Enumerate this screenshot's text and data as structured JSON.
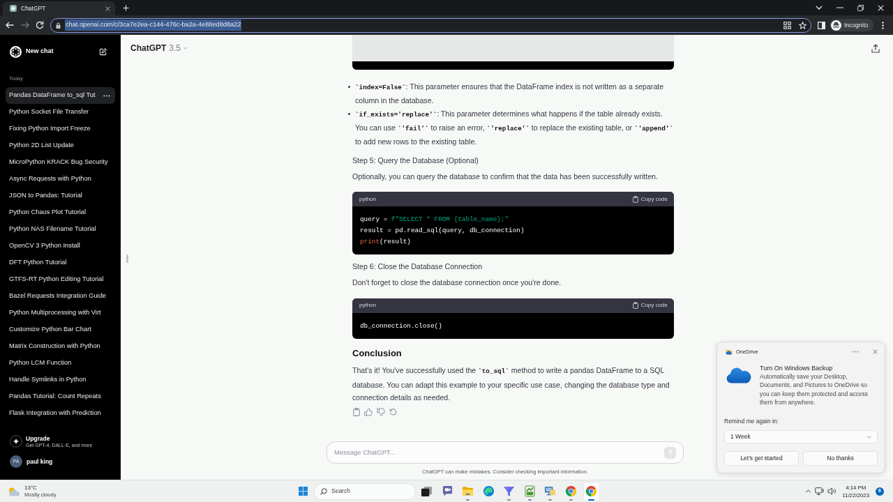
{
  "browser": {
    "tabs": [
      {
        "title": "ChatGPT",
        "selected": true
      }
    ],
    "forward_disabled": true,
    "url": "chat.openai.com/c/3ca7e2ea-c144-476c-ba2a-4e88ed8d8a22",
    "url_selected": true,
    "profile": "Incognito"
  },
  "sidebar": {
    "new_chat": "New chat",
    "section": "Today",
    "items": [
      {
        "label": "Pandas DataFrame to_sql Tut",
        "selected": true
      },
      {
        "label": "Python Socket File Transfer",
        "selected": false
      },
      {
        "label": "Fixing Python Import Freeze",
        "selected": false
      },
      {
        "label": "Python 2D List Update",
        "selected": false
      },
      {
        "label": "MicroPython KRACK Bug Security",
        "selected": false
      },
      {
        "label": "Async Requests with Python",
        "selected": false
      },
      {
        "label": "JSON to Pandas: Tutorial",
        "selected": false
      },
      {
        "label": "Python Chaos Plot Tutorial",
        "selected": false
      },
      {
        "label": "Python NAS Filename Tutorial",
        "selected": false
      },
      {
        "label": "OpenCV 3 Python Install",
        "selected": false
      },
      {
        "label": "DFT Python Tutorial",
        "selected": false
      },
      {
        "label": "GTFS-RT Python Editing Tutorial",
        "selected": false
      },
      {
        "label": "Bazel Requests Integration Guide",
        "selected": false
      },
      {
        "label": "Python Multiprocessing with Virt",
        "selected": false
      },
      {
        "label": "Customize Python Bar Chart",
        "selected": false
      },
      {
        "label": "Matrix Construction with Python",
        "selected": false
      },
      {
        "label": "Python LCM Function",
        "selected": false
      },
      {
        "label": "Handle Symlinks in Python",
        "selected": false
      },
      {
        "label": "Pandas Tutorial: Count Repeats",
        "selected": false
      },
      {
        "label": "Flask Integration with Prediction",
        "selected": false
      }
    ],
    "upgrade": {
      "title": "Upgrade",
      "subtitle": "Get GPT-4, DALL·E, and more"
    },
    "user": {
      "initials": "PA",
      "name": "paul king"
    }
  },
  "header": {
    "model": "ChatGPT",
    "version": "3.5"
  },
  "message": {
    "blocks": [
      {
        "kind": "bullets",
        "items": [
          {
            "parts": [
              {
                "kind": "code",
                "text": "`index=False`"
              },
              {
                "kind": "text",
                "text": ": This parameter ensures that the DataFrame index is not written as a separate column in the database."
              }
            ]
          },
          {
            "parts": [
              {
                "kind": "code",
                "text": "`if_exists='replace'`"
              },
              {
                "kind": "text",
                "text": ": This parameter determines what happens if the table already exists. You can use "
              },
              {
                "kind": "code",
                "text": "`'fail'`"
              },
              {
                "kind": "text",
                "text": " to raise an error, "
              },
              {
                "kind": "code",
                "text": "`'replace'`"
              },
              {
                "kind": "text",
                "text": " to replace the existing table, or "
              },
              {
                "kind": "code",
                "text": "`'append'`"
              },
              {
                "kind": "text",
                "text": " to add new rows to the existing table."
              }
            ]
          }
        ]
      },
      {
        "kind": "step",
        "text": "Step 5: Query the Database (Optional)"
      },
      {
        "kind": "paragraph",
        "parts": [
          {
            "kind": "text",
            "text": "Optionally, you can query the database to confirm that the data has been successfully written."
          }
        ]
      },
      {
        "kind": "code",
        "language": "python",
        "copy_label": "Copy code",
        "lines": [
          [
            {
              "kind": "plain",
              "text": "query = "
            },
            {
              "kind": "string",
              "text": "f\"SELECT * FROM {table_name};\""
            }
          ],
          [
            {
              "kind": "plain",
              "text": "result = pd.read_sql(query, db_connection)"
            }
          ],
          [
            {
              "kind": "builtin",
              "text": "print"
            },
            {
              "kind": "plain",
              "text": "(result)"
            }
          ]
        ]
      },
      {
        "kind": "step",
        "text": "Step 6: Close the Database Connection"
      },
      {
        "kind": "paragraph",
        "parts": [
          {
            "kind": "text",
            "text": "Don't forget to close the database connection once you're done."
          }
        ]
      },
      {
        "kind": "code",
        "language": "python",
        "copy_label": "Copy code",
        "lines": [
          [
            {
              "kind": "plain",
              "text": "db_connection.close()"
            }
          ]
        ]
      },
      {
        "kind": "heading",
        "text": "Conclusion"
      },
      {
        "kind": "paragraph",
        "parts": [
          {
            "kind": "text",
            "text": "That's it! You've successfully used the "
          },
          {
            "kind": "code",
            "text": "`to_sql`"
          },
          {
            "kind": "text",
            "text": " method to write a pandas DataFrame to a SQL database. You can adapt this example to your specific use case, changing the database type and connection details as needed."
          }
        ]
      }
    ]
  },
  "composer": {
    "placeholder": "Message ChatGPT...",
    "send_disabled": true,
    "disclaimer": "ChatGPT can make mistakes. Consider checking important information."
  },
  "notification": {
    "app": "OneDrive",
    "title": "Turn On Windows Backup",
    "body": "Automatically save your Desktop, Documents, and Pictures to OneDrive so you can keep them protected and access them from anywhere.",
    "remind_label": "Remind me again in:",
    "remind_value": "1 Week",
    "buttons": [
      "Let's get started",
      "No thanks"
    ]
  },
  "taskbar": {
    "weather": {
      "temperature": "13°C",
      "condition": "Mostly cloudy"
    },
    "search": {
      "placeholder": "Search"
    },
    "apps": [
      {
        "kind": "taskview",
        "running": false,
        "active": false
      },
      {
        "kind": "chat",
        "running": false,
        "active": false
      },
      {
        "kind": "folder",
        "running": true,
        "active": false
      },
      {
        "kind": "edge",
        "running": false,
        "active": false
      },
      {
        "kind": "funnel",
        "running": true,
        "active": false
      },
      {
        "kind": "chart",
        "running": true,
        "active": false
      },
      {
        "kind": "screen",
        "running": true,
        "active": false
      },
      {
        "kind": "chrome",
        "running": true,
        "active": false
      },
      {
        "kind": "chrome",
        "running": true,
        "active": true
      }
    ],
    "time": "4:14 PM",
    "date": "11/22/2023",
    "badge": "6"
  }
}
